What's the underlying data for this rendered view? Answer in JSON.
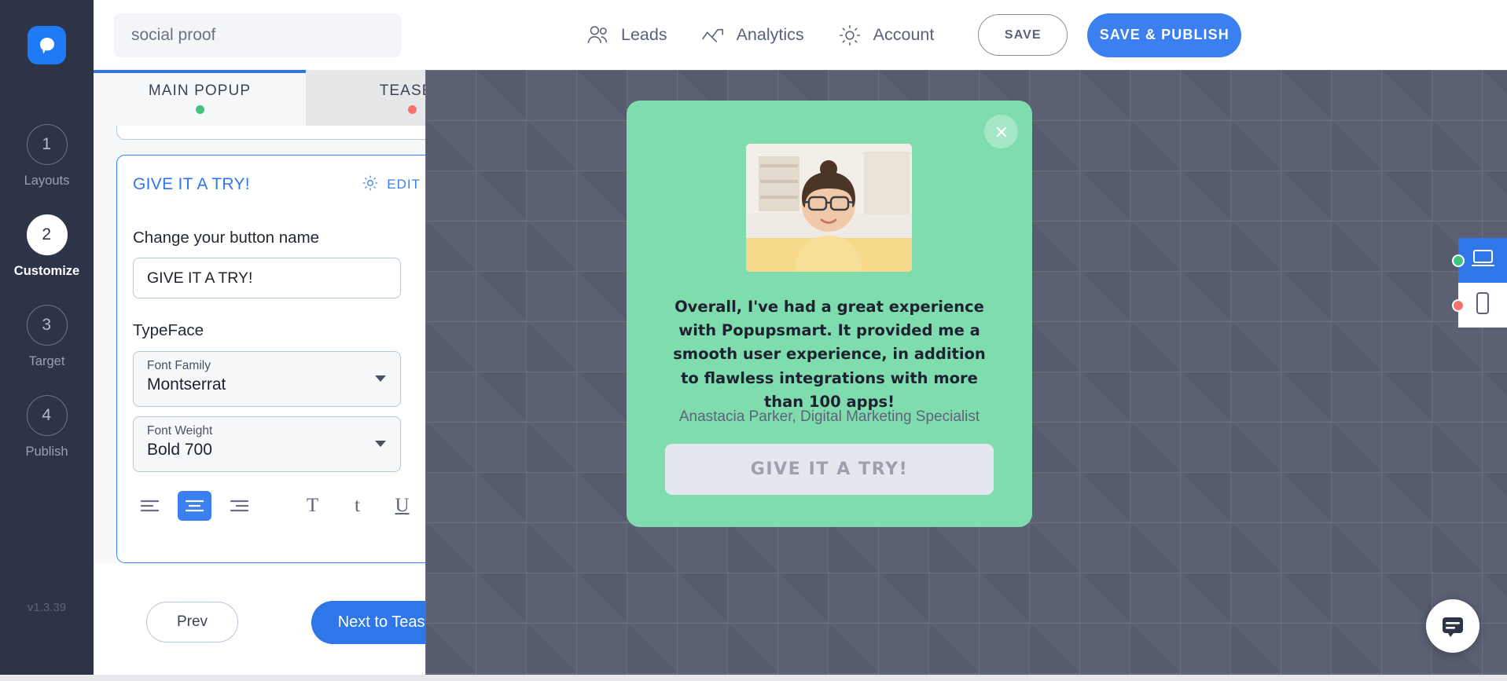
{
  "app": {
    "logo_icon": "popupsmart-logo-icon",
    "version": "v1.3.39"
  },
  "search": {
    "value": "social proof",
    "placeholder": "social proof"
  },
  "topnav": {
    "items": [
      {
        "label": "Leads",
        "icon": "people-icon"
      },
      {
        "label": "Analytics",
        "icon": "chart-line-icon"
      },
      {
        "label": "Account",
        "icon": "gear-icon"
      }
    ],
    "save_label": "SAVE",
    "publish_label": "SAVE & PUBLISH",
    "publish_color": "#3b7ff0"
  },
  "sidebar": {
    "steps": [
      {
        "number": "1",
        "label": "Layouts",
        "active": false
      },
      {
        "number": "2",
        "label": "Customize",
        "active": true
      },
      {
        "number": "3",
        "label": "Target",
        "active": false
      },
      {
        "number": "4",
        "label": "Publish",
        "active": false
      }
    ]
  },
  "tabs": [
    {
      "label": "MAIN POPUP",
      "dot_color": "#3fc47c",
      "active": true
    },
    {
      "label": "TEASER",
      "dot_color": "#f4736f",
      "active": false
    }
  ],
  "editor": {
    "card_title": "GIVE IT A TRY!",
    "edit_label": "EDIT",
    "edit_icon": "gear-icon",
    "button_name_label": "Change your button name",
    "button_name_value": "GIVE IT A TRY!",
    "typeface_label": "TypeFace",
    "font_family_label": "Font Family",
    "font_family_value": "Montserrat",
    "font_weight_label": "Font Weight",
    "font_weight_value": "Bold 700",
    "format_buttons": [
      {
        "name": "align-left-icon",
        "active": false
      },
      {
        "name": "align-center-icon",
        "active": true
      },
      {
        "name": "align-right-icon",
        "active": false
      }
    ],
    "text_style_buttons": [
      {
        "name": "uppercase-icon",
        "glyph": "T"
      },
      {
        "name": "lowercase-icon",
        "glyph": "t"
      },
      {
        "name": "underline-icon",
        "glyph": "U"
      }
    ]
  },
  "footer": {
    "prev_label": "Prev",
    "next_label": "Next to Teaser"
  },
  "preview": {
    "background_color": "#7fdcae",
    "close_icon": "close-icon",
    "image_alt": "woman-portrait-photo",
    "quote": "Overall, I've had a great experience with Popupsmart. It provided me a smooth user experience, in addition to flawless integrations with more than 100 apps!",
    "author": "Anastacia Parker, Digital Marketing Specialist",
    "cta_label": "GIVE IT A TRY!"
  },
  "device_switch": {
    "desktop": {
      "icon": "desktop-icon",
      "active": true,
      "dot_color": "#3fc47c"
    },
    "mobile": {
      "icon": "mobile-icon",
      "active": false,
      "dot_color": "#f4736f"
    }
  },
  "chat": {
    "icon": "chat-icon"
  }
}
